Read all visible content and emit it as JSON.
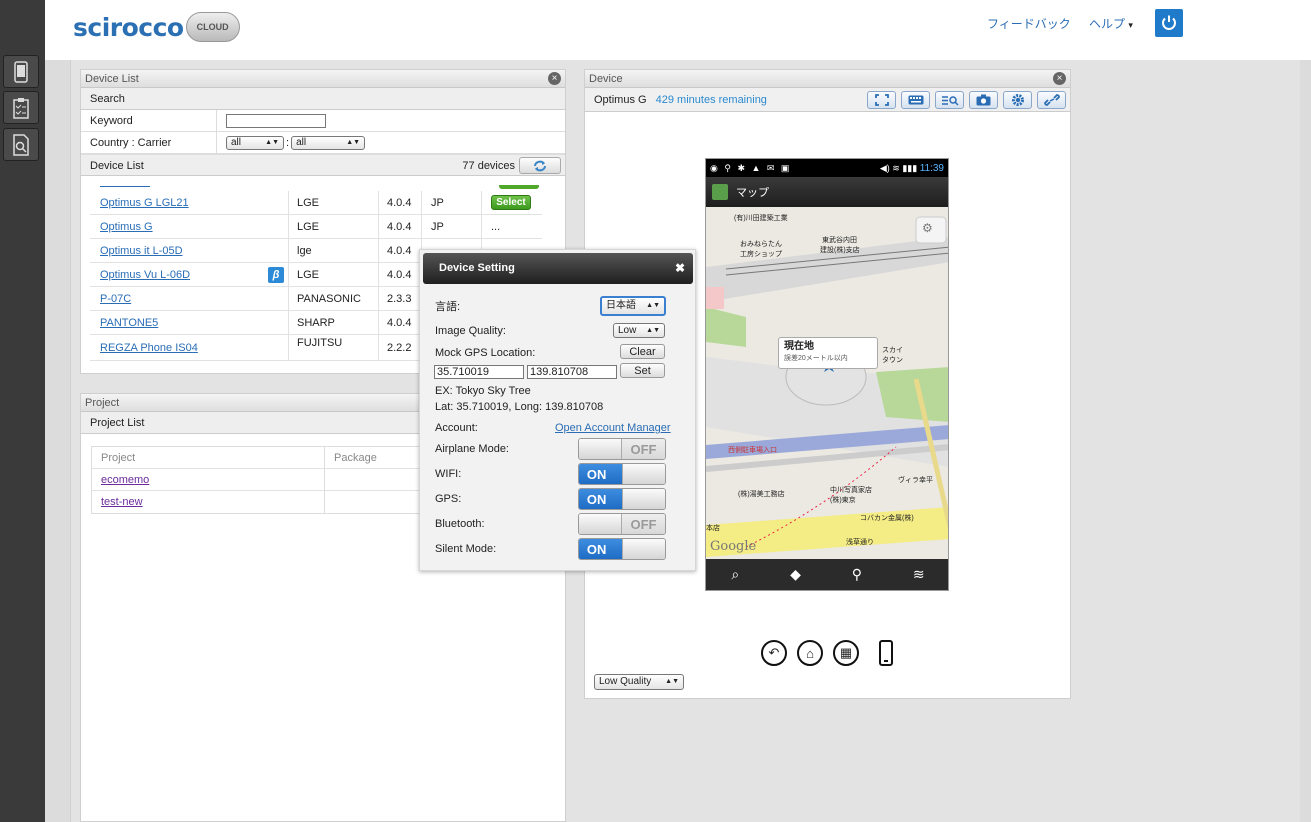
{
  "header": {
    "logo_text": "scirocco",
    "logo_badge": "CLOUD",
    "feedback": "フィードバック",
    "help": "ヘルプ",
    "help_caret": "▾"
  },
  "rail": {
    "icons": [
      "phone-icon",
      "clipboard-icon",
      "document-search-icon"
    ]
  },
  "device_list_panel": {
    "title": "Device List",
    "search_label": "Search",
    "keyword_label": "Keyword",
    "keyword_value": "",
    "country_label": "Country : Carrier",
    "country_value": "all",
    "carrier_value": "all",
    "separator": ":",
    "list_label": "Device List",
    "device_count": "77 devices",
    "rows": [
      {
        "name": "Optimus G LGL21",
        "maker": "LGE",
        "version": "4.0.4",
        "country": "JP",
        "action": "Select",
        "beta": false
      },
      {
        "name": "Optimus G",
        "maker": "LGE",
        "version": "4.0.4",
        "country": "JP",
        "action": "...",
        "beta": false
      },
      {
        "name": "Optimus it L-05D",
        "maker": "lge",
        "version": "4.0.4",
        "country": "",
        "action": "",
        "beta": false
      },
      {
        "name": "Optimus Vu L-06D",
        "maker": "LGE",
        "version": "4.0.4",
        "country": "",
        "action": "",
        "beta": true
      },
      {
        "name": "P-07C",
        "maker": "PANASONIC",
        "version": "2.3.3",
        "country": "",
        "action": "",
        "beta": false
      },
      {
        "name": "PANTONE5",
        "maker": "SHARP",
        "version": "4.0.4",
        "country": "",
        "action": "",
        "beta": false
      },
      {
        "name": "REGZA Phone IS04",
        "maker": "FUJITSU",
        "version": "2.2.2",
        "country": "",
        "action": "",
        "beta": false
      }
    ],
    "beta_symbol": "β"
  },
  "project_panel": {
    "title": "Project",
    "list_label": "Project List",
    "col_project": "Project",
    "col_package": "Package",
    "projects": [
      "ecomemo",
      "test-new"
    ]
  },
  "device_panel": {
    "title": "Device",
    "device_name": "Optimus G",
    "remaining": "429 minutes remaining",
    "quality": "Low Quality",
    "toolbar_icons": [
      "fullscreen-icon",
      "keyboard-icon",
      "log-icon",
      "camera-icon",
      "settings-icon",
      "disconnect-icon"
    ],
    "phone": {
      "time": "11:39",
      "app_title": "マップ",
      "callout_title": "現在地",
      "callout_sub": "誤差20メートル以内",
      "google": "Google",
      "map_labels": [
        "(有)川田建築工業",
        "東武谷内田",
        "建設(株)支店",
        "おみねらたん",
        "工房ショップ",
        "スカイ",
        "タウン",
        "西側駐車場入口",
        "(株)湯美工務店",
        "中川写真家店",
        "(株)東京",
        "ヴィラ幸平",
        "コバカン金属(株)",
        "浅草通り",
        "本店"
      ]
    }
  },
  "device_setting": {
    "title": "Device Setting",
    "language_label": "言語:",
    "language_value": "日本語",
    "quality_label": "Image Quality:",
    "quality_value": "Low",
    "gps_label": "Mock GPS Location:",
    "clear_label": "Clear",
    "lat_value": "35.710019",
    "lng_value": "139.810708",
    "set_label": "Set",
    "example": "EX: Tokyo Sky Tree",
    "example_coords": "Lat: 35.710019, Long: 139.810708",
    "account_label": "Account:",
    "account_link": "Open Account Manager",
    "toggles": [
      {
        "label": "Airplane Mode:",
        "state": "OFF"
      },
      {
        "label": "WIFI:",
        "state": "ON"
      },
      {
        "label": "GPS:",
        "state": "ON"
      },
      {
        "label": "Bluetooth:",
        "state": "OFF"
      },
      {
        "label": "Silent Mode:",
        "state": "ON"
      }
    ]
  },
  "colors": {
    "accent": "#2a6db5",
    "rail": "#3a3a3a",
    "toggle_on": "#1f6cc4",
    "select_green": "#3c9a1e"
  }
}
